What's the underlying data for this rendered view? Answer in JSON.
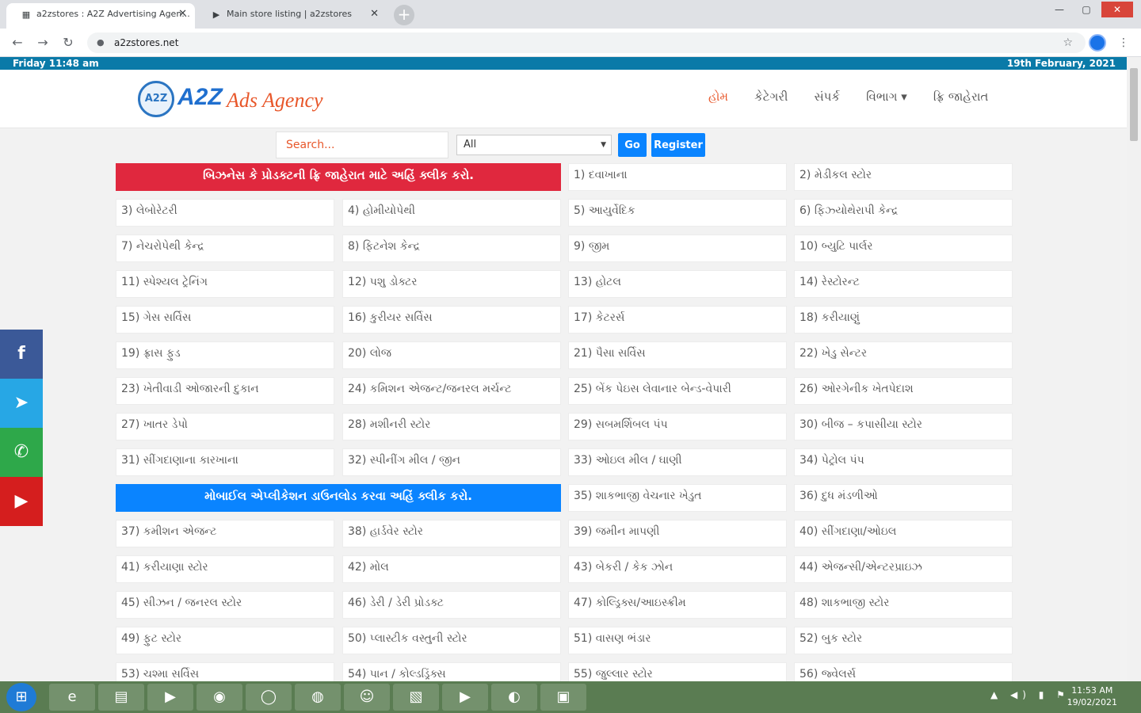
{
  "browser": {
    "tabs": [
      {
        "title": "a2zstores : A2Z Advertising Agen...",
        "favicon": "store-favicon"
      },
      {
        "title": "Main store listing | a2zstores",
        "favicon": "play-favicon"
      }
    ],
    "new_tab_label": "+",
    "address": "a2zstores.net",
    "controls": {
      "minimize": "—",
      "maximize": "▢",
      "close": "✕"
    }
  },
  "page": {
    "top_strip": {
      "day_time": "Friday 11:48 am",
      "date": "19th February, 2021"
    },
    "logo": {
      "badge": "A2Z",
      "brand": "A2Z",
      "tagline": "Ads Agency"
    },
    "nav": [
      {
        "label": "હોમ",
        "active": true
      },
      {
        "label": "કેટેગરી",
        "active": false
      },
      {
        "label": "સંપર્ક",
        "active": false
      },
      {
        "label": "વિભાગ ▾",
        "active": false
      },
      {
        "label": "ફ્રિ જાહેરાત",
        "active": false
      }
    ],
    "search": {
      "placeholder": "Search...",
      "select_value": "All",
      "go_label": "Go",
      "register_label": "Register"
    },
    "banners": {
      "business": "બિઝનેસ કે પ્રોડક્ટની ફ્રિ જાહેરાત માટે અહિં ક્લીક કરો.",
      "mobile_app": "મોબાઈલ એપ્લીકેશન ડાઉનલોડ કરવા અહિં ક્લીક કરો."
    },
    "categories": [
      "1) દવાખાના",
      "2) મેડીકલ સ્ટોર",
      "3) લેબોરેટરી",
      "4) હોમીયોપેથી",
      "5) આયુર્વેદિક",
      "6) ફિઝ્યોથેરાપી કેન્દ્ર",
      "7) નેચરોપેથી કેન્દ્ર",
      "8) ફિટનેશ કેન્દ્ર",
      "9) જીમ",
      "10) બ્યુટિ પાર્લર",
      "11) સ્પેશ્યલ ટ્રેનિંગ",
      "12) પશુ ડોક્ટર",
      "13) હોટલ",
      "14) રેસ્ટોરન્ટ",
      "15) ગેસ સર્વિસ",
      "16) કુરીયર સર્વિસ",
      "17) કેટરર્સ",
      "18) કરીયાણું",
      "19) ફ્રાસ ફુડ",
      "20) લોજ",
      "21) પૈસા સર્વિસ",
      "22) ખેડુ સેન્ટર",
      "23) ખેતીવાડી ઓજારની દુકાન",
      "24) કમિશન એજન્ટ/જનરલ મર્ચન્ટ",
      "25) બેંક પેઇસ લેવાનાર બેન્ડ-વેપારી",
      "26) ઓરગેનીક ખેતપેદાશ",
      "27) ખાતર ડેપો",
      "28) મશીનરી સ્ટોર",
      "29) સબમર્શિબલ પંપ",
      "30) બીજ – કપાસીયા સ્ટોર",
      "31) સીંગદાણાના કારખાના",
      "32) સ્પીનીંગ મીલ / જીન",
      "33) ઓઇલ મીલ / ઘાણી",
      "34) પેટ્રોલ પંપ",
      "35) શાકભાજી વેચનાર ખેડુત",
      "36) દુધ મંડળીઓ",
      "37) કમીશન એજન્ટ",
      "38) હાર્ડવેર સ્ટોર",
      "39) જમીન માપણી",
      "40) સીંગદાણા/ઓઇલ",
      "41) કરીયાણા સ્ટોર",
      "42) મોલ",
      "43) બેકરી / કેક ઝોન",
      "44) એજન્સી/એન્ટરપ્રાઇઝ",
      "45) સીઝન / જનરલ સ્ટોર",
      "46) ડેરી / ડેરી પ્રોડક્ટ",
      "47) કોલ્ડ્રિક્સ/આઇસ્ક્રીમ",
      "48) શાકભાજી સ્ટોર",
      "49) ફુટ સ્ટોર",
      "50) પ્લાસ્ટીક વસ્તુની સ્ટોર",
      "51) વાસણ ભંડાર",
      "52) બુક સ્ટોર",
      "53) ચશ્મા સર્વિસ",
      "54) પાન / કોલ્ડડ્રિંક્સ",
      "55) જુલ્લાર સ્ટોર",
      "56) જ્વેલર્સ"
    ]
  },
  "social": {
    "facebook": "f",
    "telegram": "➤",
    "whatsapp": "✆",
    "youtube": "▶"
  },
  "taskbar": {
    "start": "⊞",
    "apps": [
      "e",
      "▤",
      "▶",
      "◉",
      "◯",
      "◍",
      "☺",
      "▧",
      "▶",
      "◐",
      "▣"
    ],
    "tray_icons": "▲ ◀) ▮ ⚑",
    "time": "11:53 AM",
    "date": "19/02/2021"
  }
}
